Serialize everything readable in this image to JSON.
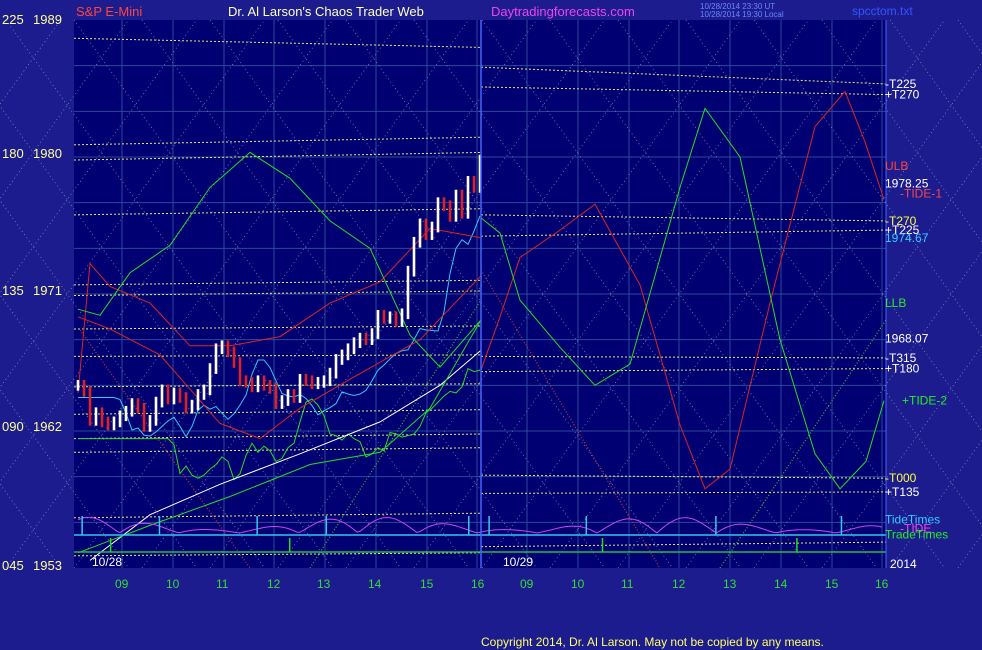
{
  "header": {
    "symbol": "S&P E-Mini",
    "title": "Dr. Al Larson's Chaos Trader Web",
    "site": "Daytradingforecasts.com",
    "timestamp_1": "10/28/2014 23:30 UT",
    "timestamp_2": "10/28/2014 19:30 Local",
    "filename": "spcctom.txt"
  },
  "footer": {
    "copyright": "Copyright 2014, Dr. Al Larson. May not be copied by any means.",
    "year": "2014"
  },
  "colors": {
    "background": "#1c1c8e",
    "plot_bg": "#000072",
    "grid": "#2a4a9a",
    "yellow": "#e8e870",
    "red": "#dd2222",
    "green": "#22dd22",
    "cyan": "#33c8ee",
    "white": "#ffffff",
    "magenta": "#cc44ee",
    "label_red": "#ff4444",
    "label_green": "#22ee22",
    "label_cyan": "#33ccff",
    "label_yellow": "#ffff44",
    "label_white": "#ffffff",
    "label_magenta": "#ee44ee",
    "tick_label": "#ffff99"
  },
  "chart_data": {
    "type": "line",
    "y_axis_labels": [
      {
        "left": "225",
        "right": "1989"
      },
      {
        "left": "180",
        "right": "1980"
      },
      {
        "left": "135",
        "right": "1971"
      },
      {
        "left": "090",
        "right": "1962"
      },
      {
        "left": "045",
        "right": "1953"
      }
    ],
    "ylim": [
      1953,
      1989
    ],
    "x_hours_day1": [
      "09",
      "10",
      "11",
      "12",
      "13",
      "14",
      "15",
      "16"
    ],
    "x_hours_day2": [
      "09",
      "10",
      "11",
      "12",
      "13",
      "14",
      "15",
      "16"
    ],
    "date_labels": [
      "10/28",
      "10/29"
    ],
    "right_labels": [
      {
        "text": "-T225",
        "color": "label_white",
        "value": 1984.8
      },
      {
        "text": "+T270",
        "color": "label_white",
        "value": 1984.1
      },
      {
        "text": "ULB",
        "color": "label_red",
        "value": 1979.4
      },
      {
        "text": "1978.25",
        "color": "label_white",
        "value": 1978.25
      },
      {
        "text": "-TIDE-1",
        "color": "label_red",
        "value": 1977.6
      },
      {
        "text": "-T270",
        "color": "label_yellow",
        "value": 1975.8
      },
      {
        "text": "+T225",
        "color": "label_white",
        "value": 1975.2
      },
      {
        "text": "1974.67",
        "color": "label_cyan",
        "value": 1974.67
      },
      {
        "text": "LLB",
        "color": "label_green",
        "value": 1970.4
      },
      {
        "text": "1968.07",
        "color": "label_white",
        "value": 1968.07
      },
      {
        "text": "-T315",
        "color": "label_white",
        "value": 1966.8
      },
      {
        "text": "+T180",
        "color": "label_white",
        "value": 1966.1
      },
      {
        "text": "+TIDE-2",
        "color": "label_green",
        "value": 1964.0
      },
      {
        "text": "-T000",
        "color": "label_yellow",
        "value": 1958.9
      },
      {
        "text": "+T135",
        "color": "label_white",
        "value": 1958.0
      },
      {
        "text": "TideTimes",
        "color": "label_cyan",
        "value": 1956.2
      },
      {
        "text": "-TIDE",
        "color": "label_magenta",
        "value": 1955.6
      },
      {
        "text": "TradeTimes",
        "color": "label_green",
        "value": 1955.2
      }
    ],
    "yellow_levels_day1": [
      [
        1987.8,
        1987.2
      ],
      [
        1980.8,
        1981.3
      ],
      [
        1979.8,
        1980.3
      ],
      [
        1976.2,
        1976.6
      ],
      [
        1971.6,
        1971.9
      ],
      [
        1970.9,
        1971.2
      ],
      [
        1968.7,
        1968.9
      ],
      [
        1966.9,
        1967.0
      ],
      [
        1964.9,
        1965.1
      ],
      [
        1963.1,
        1963.4
      ],
      [
        1961.5,
        1961.8
      ],
      [
        1960.6,
        1960.9
      ],
      [
        1956.3,
        1956.6
      ],
      [
        1953.8,
        1954.0
      ]
    ],
    "yellow_levels_day2": [
      [
        1985.9,
        1984.8
      ],
      [
        1984.6,
        1984.1
      ],
      [
        1976.2,
        1975.8
      ],
      [
        1974.8,
        1975.2
      ],
      [
        1966.9,
        1966.8
      ],
      [
        1965.9,
        1966.1
      ],
      [
        1959.1,
        1958.9
      ],
      [
        1957.9,
        1958.0
      ],
      [
        1954.4,
        1954.7
      ]
    ],
    "price_close_day1": [
      1965.0,
      1964.6,
      1962.7,
      1963.2,
      1962.6,
      1962.4,
      1962.6,
      1963.0,
      1963.3,
      1963.8,
      1963.5,
      1962.3,
      1962.7,
      1963.9,
      1964.7,
      1964.1,
      1964.5,
      1964.2,
      1963.5,
      1963.7,
      1964.4,
      1964.7,
      1966.1,
      1967.4,
      1967.6,
      1967.2,
      1966.5,
      1965.3,
      1965.2,
      1964.9,
      1965.3,
      1965.0,
      1964.8,
      1963.8,
      1964.0,
      1964.4,
      1964.2,
      1965.4,
      1965.3,
      1965.1,
      1965.2,
      1965.3,
      1965.8,
      1966.7,
      1967.0,
      1967.4,
      1967.8,
      1968.1,
      1968.0,
      1968.4,
      1969.6,
      1969.4,
      1969.5,
      1969.2,
      1969.7,
      1972.5,
      1974.4,
      1975.6,
      1974.9,
      1975.4,
      1977.0,
      1976.8,
      1976.1,
      1977.5,
      1976.3,
      1978.4,
      1978.0,
      1979.8
    ],
    "tide_times_day1": [
      0.02,
      0.21,
      0.45,
      0.62,
      0.97
    ],
    "trade_times_day1": [
      0.09,
      0.53
    ],
    "tide_times_day2": [
      0.02,
      0.26,
      0.58,
      0.89
    ],
    "trade_times_day2": [
      0.3,
      0.78
    ]
  }
}
